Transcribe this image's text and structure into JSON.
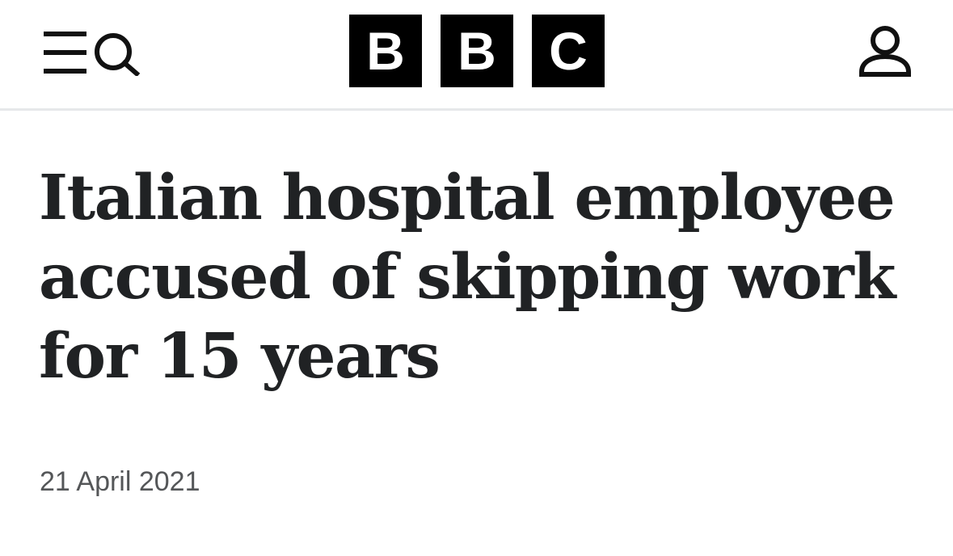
{
  "header": {
    "logo_letters": [
      "B",
      "B",
      "C"
    ],
    "icons": {
      "menu": "menu-icon",
      "search": "search-icon",
      "account": "account-icon"
    }
  },
  "article": {
    "headline": "Italian hospital employee accused of skipping work for 15 years",
    "date": "21 April 2021"
  },
  "colors": {
    "text": "#202224",
    "date": "#545658",
    "logo_bg": "#000000",
    "logo_fg": "#ffffff",
    "divider": "#e6e8ea"
  }
}
